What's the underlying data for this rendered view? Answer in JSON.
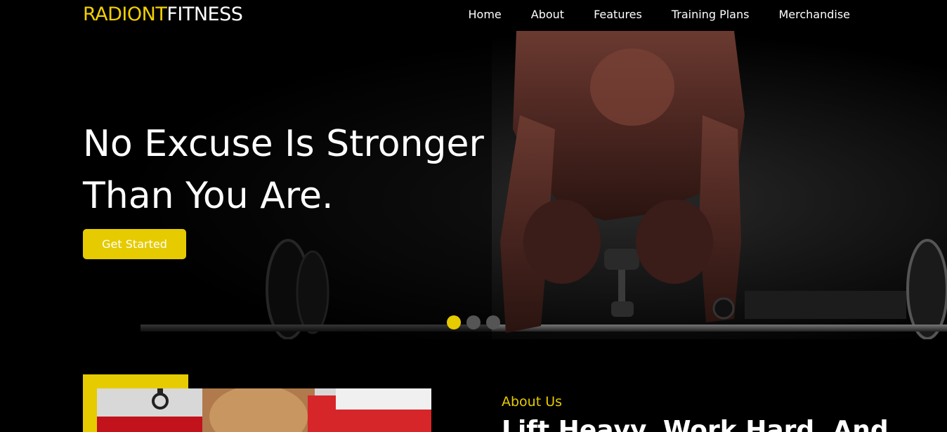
{
  "logo": {
    "part1": "RADIONT",
    "part2": "FITNESS"
  },
  "nav": [
    {
      "label": "Home"
    },
    {
      "label": "About"
    },
    {
      "label": "Features"
    },
    {
      "label": "Training Plans"
    },
    {
      "label": "Merchandise"
    }
  ],
  "hero": {
    "title_line1": "No Excuse Is Stronger",
    "title_line2": "Than You Are.",
    "cta_label": "Get Started",
    "slides_total": 3,
    "slide_active": 1
  },
  "about": {
    "eyebrow": "About Us",
    "heading": "Lift Heavy, Work Hard, And"
  },
  "colors": {
    "accent": "#e6cb00",
    "background": "#000000",
    "text": "#ffffff"
  }
}
